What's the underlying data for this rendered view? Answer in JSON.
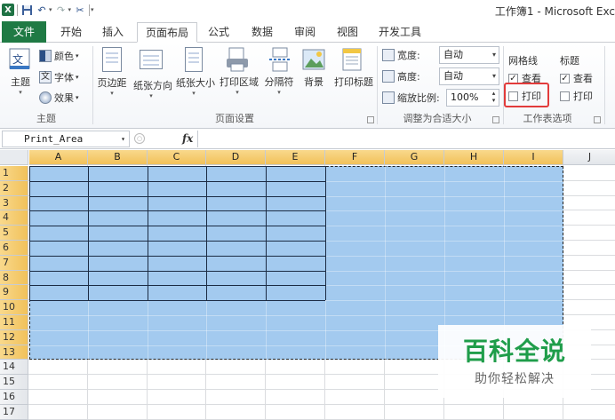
{
  "window": {
    "title": "工作簿1 - Microsoft Exc"
  },
  "quick_access": {
    "app_icon": "excel-icon",
    "items": [
      "save-icon",
      "undo-icon",
      "redo-icon",
      "customize-icon"
    ]
  },
  "tabs": [
    {
      "label": "文件"
    },
    {
      "label": "开始"
    },
    {
      "label": "插入"
    },
    {
      "label": "页面布局"
    },
    {
      "label": "公式"
    },
    {
      "label": "数据"
    },
    {
      "label": "审阅"
    },
    {
      "label": "视图"
    },
    {
      "label": "开发工具"
    }
  ],
  "ribbon": {
    "theme_group": {
      "label": "主题",
      "theme_button": "主题",
      "colors": "颜色",
      "fonts": "字体",
      "effects": "效果"
    },
    "page_setup_group": {
      "label": "页面设置",
      "buttons": [
        "页边距",
        "纸张方向",
        "纸张大小",
        "打印区域",
        "分隔符",
        "背景",
        "打印标题"
      ]
    },
    "scale_group": {
      "label": "调整为合适大小",
      "width_label": "宽度:",
      "width_value": "自动",
      "height_label": "高度:",
      "height_value": "自动",
      "scale_label": "缩放比例:",
      "scale_value": "100%"
    },
    "sheet_options_group": {
      "label": "工作表选项",
      "gridlines_head": "网格线",
      "gridlines_view": "查看",
      "gridlines_print": "打印",
      "headings_head": "标题",
      "headings_view": "查看",
      "headings_print": "打印",
      "gridlines_view_checked": true,
      "gridlines_print_checked": false,
      "headings_view_checked": true,
      "headings_print_checked": false
    }
  },
  "formula_bar": {
    "name_box": "Print_Area",
    "fx_label": "fx",
    "formula": ""
  },
  "columns": [
    "A",
    "B",
    "C",
    "D",
    "E",
    "F",
    "G",
    "H",
    "I",
    "J"
  ],
  "rows": [
    "1",
    "2",
    "3",
    "4",
    "5",
    "6",
    "7",
    "8",
    "9",
    "10",
    "11",
    "12",
    "13",
    "14",
    "15",
    "16",
    "17"
  ],
  "watermark": {
    "title": "百科全说",
    "subtitle": "助你轻松解决"
  },
  "colors": {
    "file_tab": "#1f7a44",
    "selection_fill": "#9ec7ee",
    "highlight": "#e23b3b",
    "watermark_green": "#1f9d4a"
  }
}
